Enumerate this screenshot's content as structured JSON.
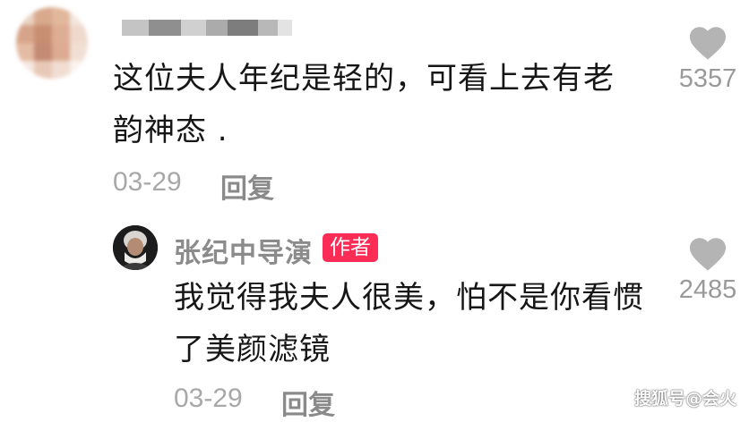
{
  "comment": {
    "lines": [
      "这位夫人年纪是轻的，可看上去有老",
      "韵神态 ."
    ],
    "date": "03-29",
    "reply_label": "回复",
    "likes": "5357"
  },
  "reply": {
    "author": "张纪中导演",
    "badge": "作者",
    "lines": [
      "我觉得我夫人很美，怕不是你看惯",
      "了美颜滤镜"
    ],
    "date": "03-29",
    "reply_label": "回复",
    "likes": "2485"
  },
  "watermark": "搜狐号@会火",
  "colors": {
    "badge": "#fb2c55",
    "meta": "#a8a8a8",
    "heart": "#b4b4b4"
  }
}
